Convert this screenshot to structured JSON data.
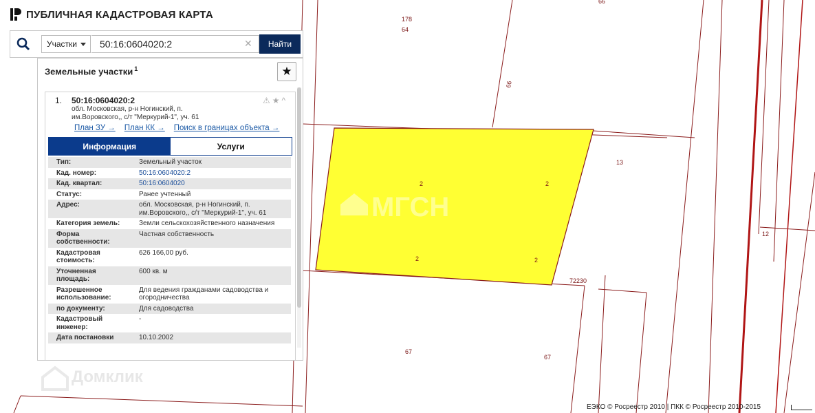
{
  "app": {
    "title": "ПУБЛИЧНАЯ КАДАСТРОВАЯ КАРТА"
  },
  "search": {
    "type_selected": "Участки",
    "query": "50:16:0604020:2",
    "clear_glyph": "✕",
    "find_label": "Найти"
  },
  "panel": {
    "title": "Земельные участки",
    "count": "1",
    "fav_glyph": "★"
  },
  "result": {
    "number": "1.",
    "cad_number": "50:16:0604020:2",
    "address": "обл. Московская, р-н Ногинский, п. им.Воровского,, с/т \"Меркурий-1\", уч. 61",
    "action_icons": [
      "⚠",
      "★",
      "^"
    ],
    "links": [
      "План ЗУ →",
      "План КК →",
      "Поиск в границах объекта →"
    ],
    "tabs": [
      "Информация",
      "Услуги"
    ],
    "fields": [
      {
        "label": "Тип:",
        "value": "Земельный участок"
      },
      {
        "label": "Кад. номер:",
        "value": "50:16:0604020:2"
      },
      {
        "label": "Кад. квартал:",
        "value": "50:16:0604020"
      },
      {
        "label": "Статус:",
        "value": "Ранее учтенный"
      },
      {
        "label": "Адрес:",
        "value": "обл. Московская, р-н Ногинский, п. им.Воровского,, с/т \"Меркурий-1\", уч. 61"
      },
      {
        "label": "Категория земель:",
        "value": "Земли сельскохозяйственного назначения"
      },
      {
        "label": "Форма собственности:",
        "value": "Частная собственность"
      },
      {
        "label": "Кадастровая стоимость:",
        "value": "626 166,00 руб."
      },
      {
        "label": "Уточненная площадь:",
        "value": "600 кв. м"
      },
      {
        "label": "Разрешенное использование:",
        "value": "Для ведения гражданами садоводства и огородничества"
      },
      {
        "label": "по документу:",
        "value": "Для садоводства"
      },
      {
        "label": "Кадастровый инженер:",
        "value": "-"
      },
      {
        "label": "Дата постановки",
        "value": "10.10.2002"
      }
    ]
  },
  "map": {
    "parcel_fill": "#ffff33",
    "line_color": "#8a1b1b",
    "labels": [
      "178",
      "64",
      "66",
      "66",
      "13",
      "12",
      "72230",
      "67",
      "67",
      "2",
      "2",
      "2",
      "2"
    ],
    "watermarks": [
      "МГСН",
      "Домклик"
    ]
  },
  "footer": {
    "copyright": "ЕЭКО © Росреестр 2010 | ПКК © Росреестр 2010-2015"
  }
}
